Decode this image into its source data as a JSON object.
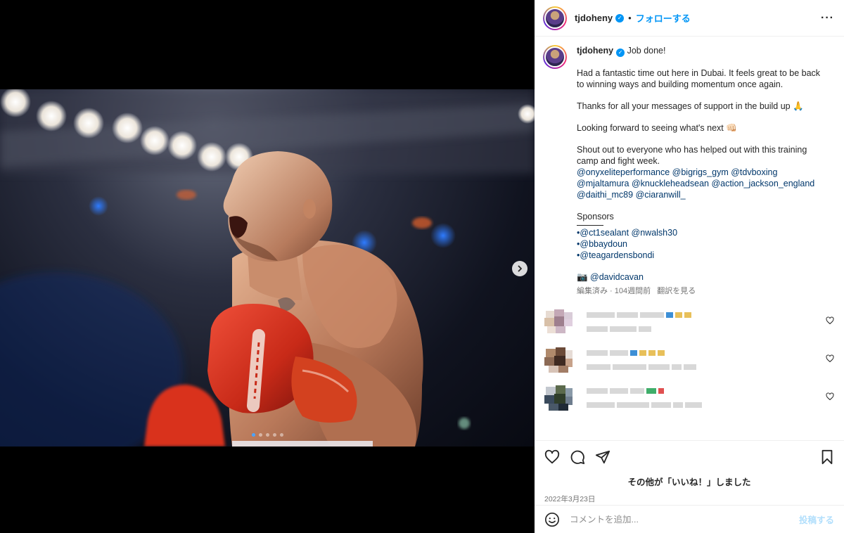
{
  "post": {
    "username": "tjdoheny",
    "verified_glyph": "✓",
    "separator": "•",
    "follow_label": "フォローする",
    "more_label": "···"
  },
  "caption": {
    "username": "tjdoheny",
    "title": "Job done!",
    "p1": "Had a fantastic time out here in Dubai. It feels great to be back to winning ways and building momentum once again.",
    "p2": "Thanks for all your messages of support in the build up 🙏",
    "p3": "Looking forward to seeing what's next 👊🏻",
    "p4": "Shout out to everyone who has helped out with this training camp and fight week.",
    "mentions": "@onyxeliteperformance @bigrigs_gym @tdvboxing @mjaltamura @knuckleheadsean @action_jackson_england @daithi_mc89 @ciaranwill_",
    "sponsors_label": "Sponsors",
    "sponsor1": "•@ct1sealant @nwalsh30",
    "sponsor2": "•@bbaydoun",
    "sponsor3": "•@teagardensbondi",
    "photo_credit": "📷 @davidcavan",
    "meta_edited": "編集済み · 104週間前",
    "meta_translate": "翻訳を見る"
  },
  "carousel": {
    "slide_count": 5,
    "active_index": 0
  },
  "actions": {
    "likes_text_bold": "その他",
    "likes_text_rest": "が「いいね！」しました",
    "date": "2022年3月23日"
  },
  "comment_box": {
    "placeholder": "コメントを追加...",
    "post_label": "投稿する"
  },
  "icons": {
    "like": "heart-icon",
    "comment": "comment-icon",
    "share": "share-icon",
    "save": "bookmark-icon",
    "emoji": "emoji-icon",
    "next": "chevron-right-icon"
  },
  "colors": {
    "accent": "#0095f6",
    "glove": "#d8331f"
  }
}
